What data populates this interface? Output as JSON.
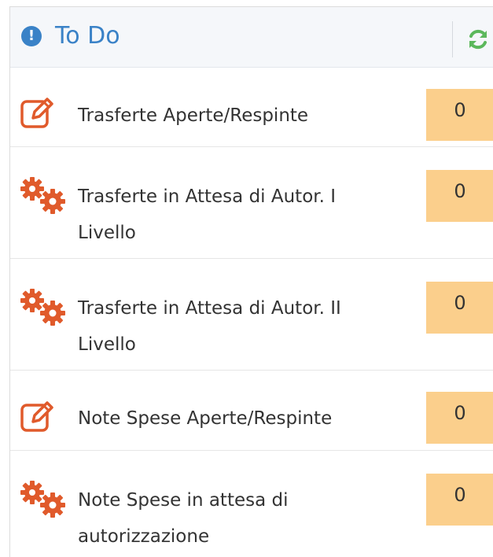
{
  "panel": {
    "title": "To Do",
    "header_icon_glyph": "!",
    "header_icon_name": "info-circle-icon",
    "refresh_icon_name": "refresh-icon",
    "accent_color": "#3a82c7",
    "icon_color": "#e05a2b",
    "badge_color": "#fbcf8c"
  },
  "items": [
    {
      "icon": "edit-icon",
      "label": "Trasferte Aperte/Respinte",
      "count": "0"
    },
    {
      "icon": "gears-icon",
      "label": "Trasferte in Attesa di Autor. I Livello",
      "count": "0"
    },
    {
      "icon": "gears-icon",
      "label": "Trasferte in Attesa di Autor. II Livello",
      "count": "0"
    },
    {
      "icon": "edit-icon",
      "label": "Note Spese Aperte/Respinte",
      "count": "0"
    },
    {
      "icon": "gears-icon",
      "label": "Note Spese in attesa di autorizzazione",
      "count": "0"
    }
  ]
}
